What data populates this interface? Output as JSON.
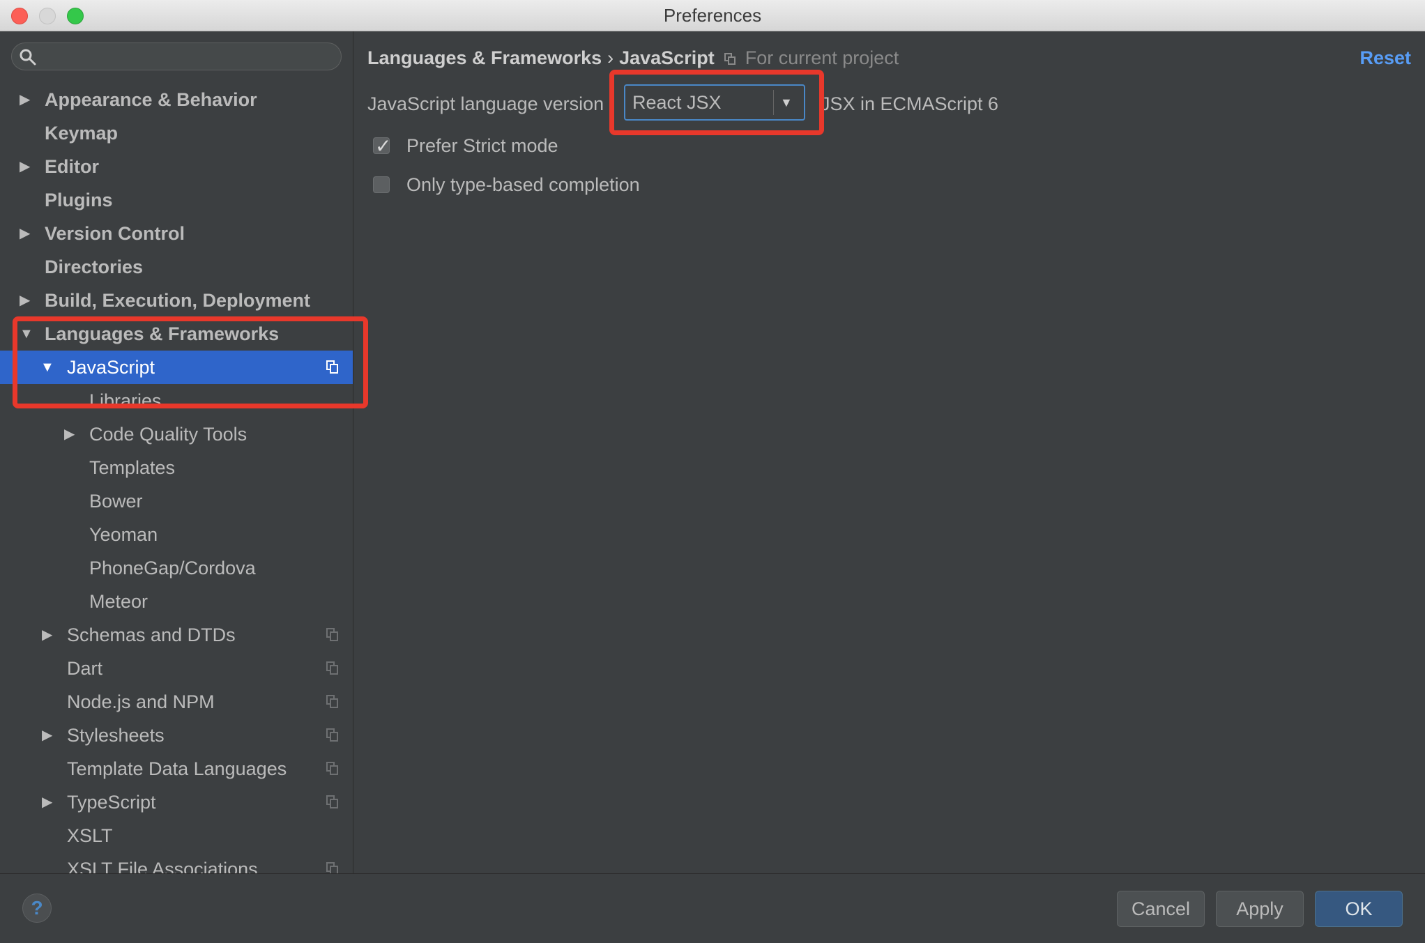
{
  "window": {
    "title": "Preferences"
  },
  "sidebar": {
    "search_placeholder": "",
    "items": [
      {
        "label": "Appearance & Behavior"
      },
      {
        "label": "Keymap"
      },
      {
        "label": "Editor"
      },
      {
        "label": "Plugins"
      },
      {
        "label": "Version Control"
      },
      {
        "label": "Directories"
      },
      {
        "label": "Build, Execution, Deployment"
      },
      {
        "label": "Languages & Frameworks"
      },
      {
        "label": "JavaScript"
      },
      {
        "label": "Libraries"
      },
      {
        "label": "Code Quality Tools"
      },
      {
        "label": "Templates"
      },
      {
        "label": "Bower"
      },
      {
        "label": "Yeoman"
      },
      {
        "label": "PhoneGap/Cordova"
      },
      {
        "label": "Meteor"
      },
      {
        "label": "Schemas and DTDs"
      },
      {
        "label": "Dart"
      },
      {
        "label": "Node.js and NPM"
      },
      {
        "label": "Stylesheets"
      },
      {
        "label": "Template Data Languages"
      },
      {
        "label": "TypeScript"
      },
      {
        "label": "XSLT"
      },
      {
        "label": "XSLT File Associations"
      }
    ]
  },
  "main": {
    "breadcrumb": {
      "parent": "Languages & Frameworks",
      "separator": "›",
      "current": "JavaScript",
      "scope_note": "For current project"
    },
    "reset_label": "Reset",
    "language_version": {
      "label": "JavaScript language version",
      "selected": "React JSX",
      "description": "JSX in ECMAScript 6"
    },
    "checkboxes": [
      {
        "label": "Prefer Strict mode",
        "checked": true
      },
      {
        "label": "Only type-based completion",
        "checked": false
      }
    ]
  },
  "footer": {
    "help_label": "?",
    "cancel_label": "Cancel",
    "apply_label": "Apply",
    "ok_label": "OK"
  },
  "colors": {
    "background": "#3c3f41",
    "selection": "#2f65ca",
    "highlight": "#e8382b",
    "link": "#589df6"
  }
}
